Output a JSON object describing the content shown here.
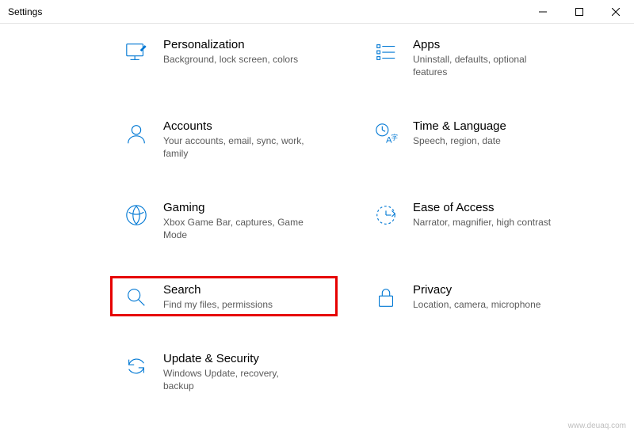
{
  "window": {
    "title": "Settings"
  },
  "categories": [
    {
      "id": "personalization",
      "title": "Personalization",
      "desc": "Background, lock screen, colors",
      "icon": "personalization-icon"
    },
    {
      "id": "apps",
      "title": "Apps",
      "desc": "Uninstall, defaults, optional features",
      "icon": "apps-icon"
    },
    {
      "id": "accounts",
      "title": "Accounts",
      "desc": "Your accounts, email, sync, work, family",
      "icon": "accounts-icon"
    },
    {
      "id": "time-language",
      "title": "Time & Language",
      "desc": "Speech, region, date",
      "icon": "time-language-icon"
    },
    {
      "id": "gaming",
      "title": "Gaming",
      "desc": "Xbox Game Bar, captures, Game Mode",
      "icon": "gaming-icon"
    },
    {
      "id": "ease-of-access",
      "title": "Ease of Access",
      "desc": "Narrator, magnifier, high contrast",
      "icon": "ease-of-access-icon"
    },
    {
      "id": "search",
      "title": "Search",
      "desc": "Find my files, permissions",
      "icon": "search-icon",
      "highlighted": true
    },
    {
      "id": "privacy",
      "title": "Privacy",
      "desc": "Location, camera, microphone",
      "icon": "privacy-icon"
    },
    {
      "id": "update-security",
      "title": "Update & Security",
      "desc": "Windows Update, recovery, backup",
      "icon": "update-security-icon"
    }
  ],
  "watermark": "www.deuaq.com",
  "colors": {
    "accent": "#0078d4",
    "highlight": "#e60000"
  }
}
